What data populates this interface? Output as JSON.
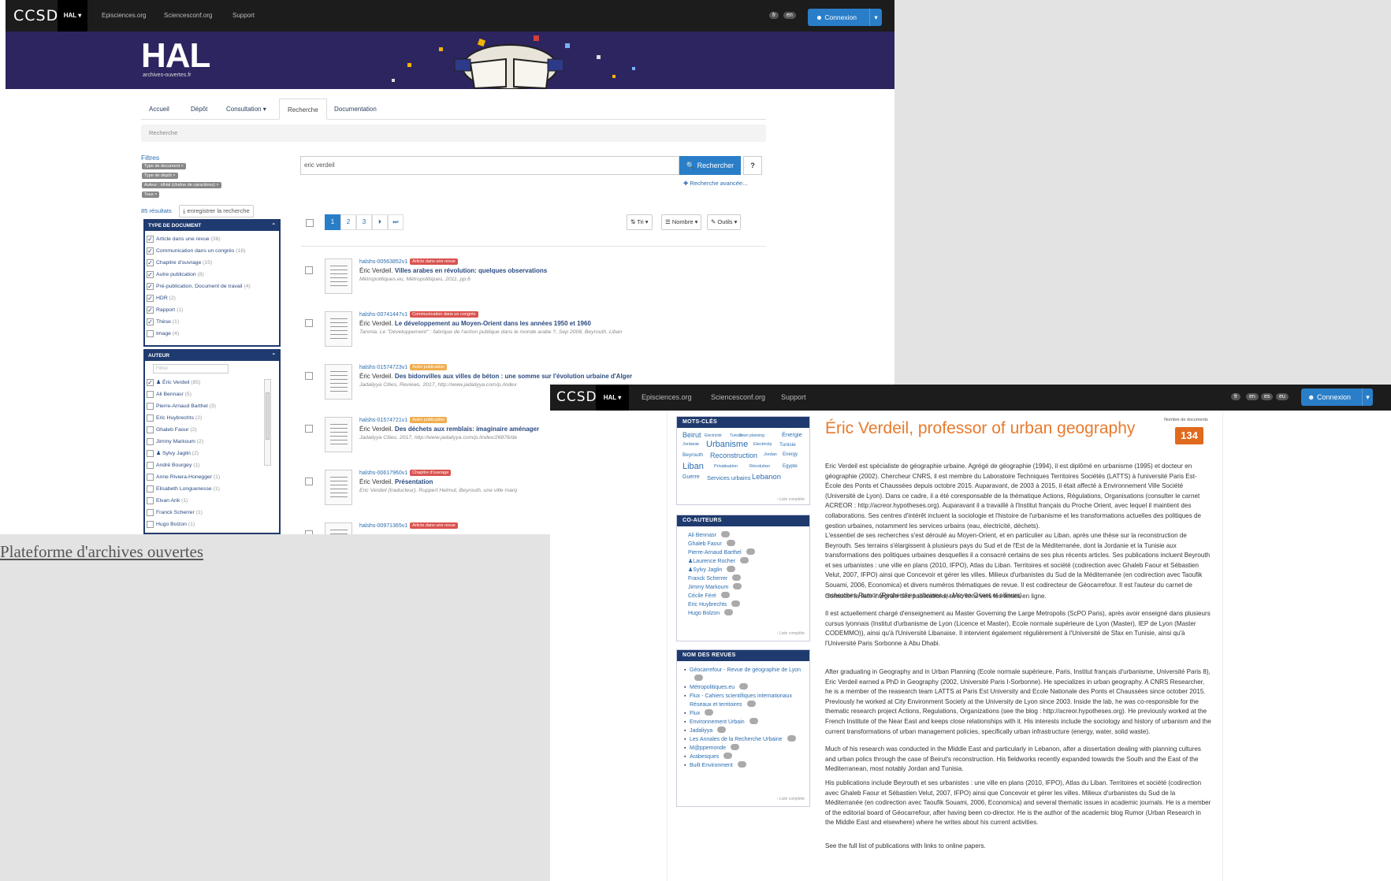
{
  "brand": {
    "ccsd": "CCSD",
    "hal": "HAL",
    "hal_big": "HAL",
    "tagline": "archives-ouvertes.fr"
  },
  "topbar": {
    "links": [
      "Episciences.org",
      "Sciencesconf.org",
      "Support"
    ],
    "lang": [
      "fr",
      "en"
    ],
    "connexion": "Connexion"
  },
  "nav": {
    "tabs": [
      "Accueil",
      "Dépôt",
      "Consultation",
      "Recherche",
      "Documentation"
    ]
  },
  "breadcrumb": "Recherche",
  "filters": {
    "label": "Filtres",
    "tags": [
      "Type de document ×",
      "Type de dépôt ×",
      "Auteur : idHal (chaîne de caractères) ×",
      "Tous ×"
    ]
  },
  "search": {
    "value": "eric verdeil",
    "button": "Rechercher",
    "help": "?",
    "advanced": "Recherche avancée..."
  },
  "results": {
    "count": "85 résultats",
    "save": "enregistrer la recherche"
  },
  "pagination": {
    "pages": [
      "1",
      "2",
      "3"
    ],
    "next": "⏭",
    "last": "⏭"
  },
  "tools": {
    "sort": "Tri",
    "count": "Nombre",
    "tools": "Outils"
  },
  "doc_types": {
    "title": "TYPE DE DOCUMENT",
    "items": [
      {
        "label": "Article dans une revue",
        "count": "(36)"
      },
      {
        "label": "Communication dans un congrès",
        "count": "(18)"
      },
      {
        "label": "Chapitre d'ouvrage",
        "count": "(15)"
      },
      {
        "label": "Autre publication",
        "count": "(8)"
      },
      {
        "label": "Pré-publication, Document de travail",
        "count": "(4)"
      },
      {
        "label": "HDR",
        "count": "(2)"
      },
      {
        "label": "Rapport",
        "count": "(1)"
      },
      {
        "label": "Thèse",
        "count": "(1)"
      },
      {
        "label": "Image",
        "count": "(4)"
      }
    ]
  },
  "authors": {
    "title": "AUTEUR",
    "filter_placeholder": "Filtrer",
    "items": [
      {
        "label": "Éric Verdeil",
        "count": "(85)"
      },
      {
        "label": "Ali Bennasr",
        "count": "(5)"
      },
      {
        "label": "Pierre-Arnaud Barthel",
        "count": "(3)"
      },
      {
        "label": "Eric Huybrechts",
        "count": "(2)"
      },
      {
        "label": "Ghaleb Faour",
        "count": "(2)"
      },
      {
        "label": "Jimmy Markoum",
        "count": "(2)"
      },
      {
        "label": "Sylvy Jaglin",
        "count": "(2)"
      },
      {
        "label": "André Bourgey",
        "count": "(1)"
      },
      {
        "label": "Anne Riviera-Honegger",
        "count": "(1)"
      },
      {
        "label": "Elisabeth Longuenesse",
        "count": "(1)"
      },
      {
        "label": "Elvan Arik",
        "count": "(1)"
      },
      {
        "label": "Franck Scherrer",
        "count": "(1)"
      },
      {
        "label": "Hugo Bolzon",
        "count": "(1)"
      }
    ]
  },
  "docs": [
    {
      "id": "halshs-00563852v1",
      "badge": "Article dans une revue",
      "badge_color": "#d9534f",
      "author": "Éric Verdeil.",
      "title": "Villes arabes en révolution: quelques observations",
      "source": "Métropolitiques.eu, Métropolitiques, 2011, pp.6"
    },
    {
      "id": "halshs-00741447v1",
      "badge": "Communication dans un congrès",
      "badge_color": "#d9534f",
      "author": "Éric Verdeil.",
      "title": "Le développement au Moyen-Orient dans les années 1950 et 1960",
      "source": "Tanmia. Le \"Développement\" : fabrique de l'action publique dans le monde arabe ?, Sep 2008, Beyrouth, Liban"
    },
    {
      "id": "halshs-01574723v1",
      "badge": "Autre publication",
      "badge_color": "#f0ad4e",
      "author": "Éric Verdeil.",
      "title": "Des bidonvilles aux villes de béton : une somme sur l'évolution urbaine d'Alger",
      "source": "Jadaliyya Cities, Reviews. 2017, http://www.jadaliyya.com/p./index"
    },
    {
      "id": "halshs-01574721v1",
      "badge": "Autre publication",
      "badge_color": "#f0ad4e",
      "author": "Éric Verdeil.",
      "title": "Des déchets aux remblais: imaginaire aménager",
      "source": "Jadaliyya Cities. 2017, http://www.jadaliyya.com/p./index/26876/de"
    },
    {
      "id": "halshs-00617960v1",
      "badge": "Chapitre d'ouvrage",
      "badge_color": "#d9534f",
      "author": "Éric Verdeil.",
      "title": "Présentation",
      "source": "Eric Verdeil (traducteur). Ruppert Helmut, Beyrouth, une ville marq"
    },
    {
      "id": "halshs-00971365v1",
      "badge": "Article dans une revue",
      "badge_color": "#d9534f",
      "author": "",
      "title": "",
      "source": ""
    }
  ],
  "caption": "Plateforme d'archives ouvertes",
  "profile": {
    "lang": [
      "fr",
      "en",
      "es",
      "eu"
    ],
    "keywords_title": "MOTS-CLÉS",
    "keywords": [
      "Beirut",
      "Electricité",
      "Tunisia",
      "Town planning",
      "Énergie",
      "Jordanie",
      "Urbanisme",
      "Electricity",
      "Tunisie",
      "Beyrouth",
      "Reconstruction",
      "Jordan",
      "Energy",
      "Liban",
      "Privatisation",
      "Révolution",
      "Egypte",
      "Guerre",
      "Services urbains",
      "Lebanon"
    ],
    "full_list": "› Liste complète",
    "coauthors_title": "CO-AUTEURS",
    "coauthors": [
      "Ali Bennasr",
      "Ghaleb Faour",
      "Pierre-Arnaud Barthel",
      "Laurence Rocher",
      "Sylvy Jaglin",
      "Franck Scherrer",
      "Jimmy Markoum",
      "Cécile Féré",
      "Eric Huybrechts",
      "Hugo Bolzon"
    ],
    "journals_title": "NOM DES REVUES",
    "journals": [
      "Géocarrefour - Revue de géographie de Lyon",
      "Métropolitiques.eu",
      "Flux - Cahiers scientifiques internationaux Réseaux et territoires",
      "Flux",
      "Environnement Urbain",
      "Jadaliyya",
      "Les Annales de la Recherche Urbaine",
      "M@ppemonde",
      "Arabesques",
      "Built Environment"
    ],
    "title": "Éric Verdeil, professor of urban geography",
    "docs_label": "Nombre de documents",
    "docs_count": "134",
    "bio": [
      "Eric Verdeil est spécialiste de géographie urbaine. Agrégé de géographie (1994), il est diplômé en urbanisme (1995) et docteur en géographie (2002). Chercheur CNRS, il est membre du Laboratoire Techniques Territoires Sociétés (LATTS) à l'université Paris Est-École des Ponts et Chaussées depuis octobre 2015. Auparavant, de 2003 à 2015, il était affecté à Environnement Ville Société (Université de Lyon). Dans ce cadre, il a été coresponsable de la thématique Actions, Régulations, Organisations (consulter le carnet ACREOR : http://acreor.hypotheses.org). Auparavant il a travaillé à l'Institut français du Proche Orient, avec lequel il maintient des collaborations. Ses centres d'intérêt incluent la sociologie et l'histoire de l'urbanisme et les transformations actuelles des politiques de gestion urbaines, notamment les services urbains (eau, électricité, déchets).",
      "L'essentiel de ses recherches s'est déroulé au Moyen-Orient, et en particulier au Liban, après une thèse sur la reconstruction de Beyrouth. Ses terrains s'élargissent à plusieurs pays du Sud et de l'Est de la Méditerranée, dont la Jordanie et la Tunisie aux transformations des politiques urbaines desquelles il a consacré certains de ses plus récents articles. Ses publications incluent Beyrouth et ses urbanistes : une ville en plans (2010, IFPO), Atlas du Liban. Territoires et société (codirection avec Ghaleb Faour et Sébastien Velut, 2007, IFPO) ainsi que Concevoir et gérer les villes. Milieux d'urbanistes du Sud de la Méditerranée (en codirection avec Taoufik Souami, 2006, Economica) et divers numéros thématiques de revue. Il est codirecteur de Géocarrefour. Il est l'auteur du carnet de recherches Rumor (Recherches urbaines au Moyen Orient et ailleurs).",
      "Consulter la liste intégrale des publications, avec liens vers les textes en ligne.",
      "Il est actuellement chargé d'enseignement au Master Governing the Large Metropolis (ScPO Paris), après avoir enseigné dans plusieurs cursus lyonnais (Institut d'urbanisme de Lyon (Licence et Master), Ecole normale supérieure de Lyon (Master), IEP de Lyon (Master CODEMMO)), ainsi qu'à l'Université Libanaise. Il intervient également régulièrement à l'Université de Sfax en Tunisie, ainsi qu'à l'Université Paris Sorbonne à Abu Dhabi.",
      "After graduating in Geography and in Urban Planning (Ecole normale supérieure, Paris, Institut français d'urbanisme, Université Paris 8), Eric Verdeil earned a PhD in Geography (2002, Université Paris I-Sorbonne). He specializes in urban geography. A CNRS Researcher, he is a member of the reasearch team LATTS at Paris Est University and Ecole Nationale des Ponts et Chaussées since october 2015. Previously he worked at City Environment Society at the University de Lyon since 2003. Inside the lab, he was co-responsible for the thematic research project Actions, Regulations, Organizations (see the blog : http://acreor.hypotheses.org). He previously  worked at the French Institute of the Near East and keeps close relationships with it. His interests include the sociology and history of urbanism and the current transformations of urban management policies, specifically urban infrastructure (energy, water, solid waste).",
      "Much of his research was conducted in the Middle East and particularly in Lebanon, after a dissertation dealing with planning cultures and urban polics through the case of Beirut's reconstruction. His fieldworks recently expanded towards the South and the East of the Mediterranean, most notably Jordan and Tunisia.",
      "His publications include Beyrouth et ses urbanistes : une ville en plans (2010, IFPO), Atlas du Liban. Territoires et société (codirection avec Ghaleb Faour et Sébastien Velut, 2007, IFPO) ainsi que Concevoir et gérer les villes. Milieux d'urbanistes du Sud de la Méditerranée (en codirection avec Taoufik Souami, 2006, Economica) and several thematic issues in academic journals. He is a member of the editorial board of Géocarrefour, after having been co-director. He is the author of the academic blog Rumor (Urban Research in the Middle East and elsewhere) where he writes about his current activities.",
      "See the full list of publications with links to online papers."
    ]
  }
}
